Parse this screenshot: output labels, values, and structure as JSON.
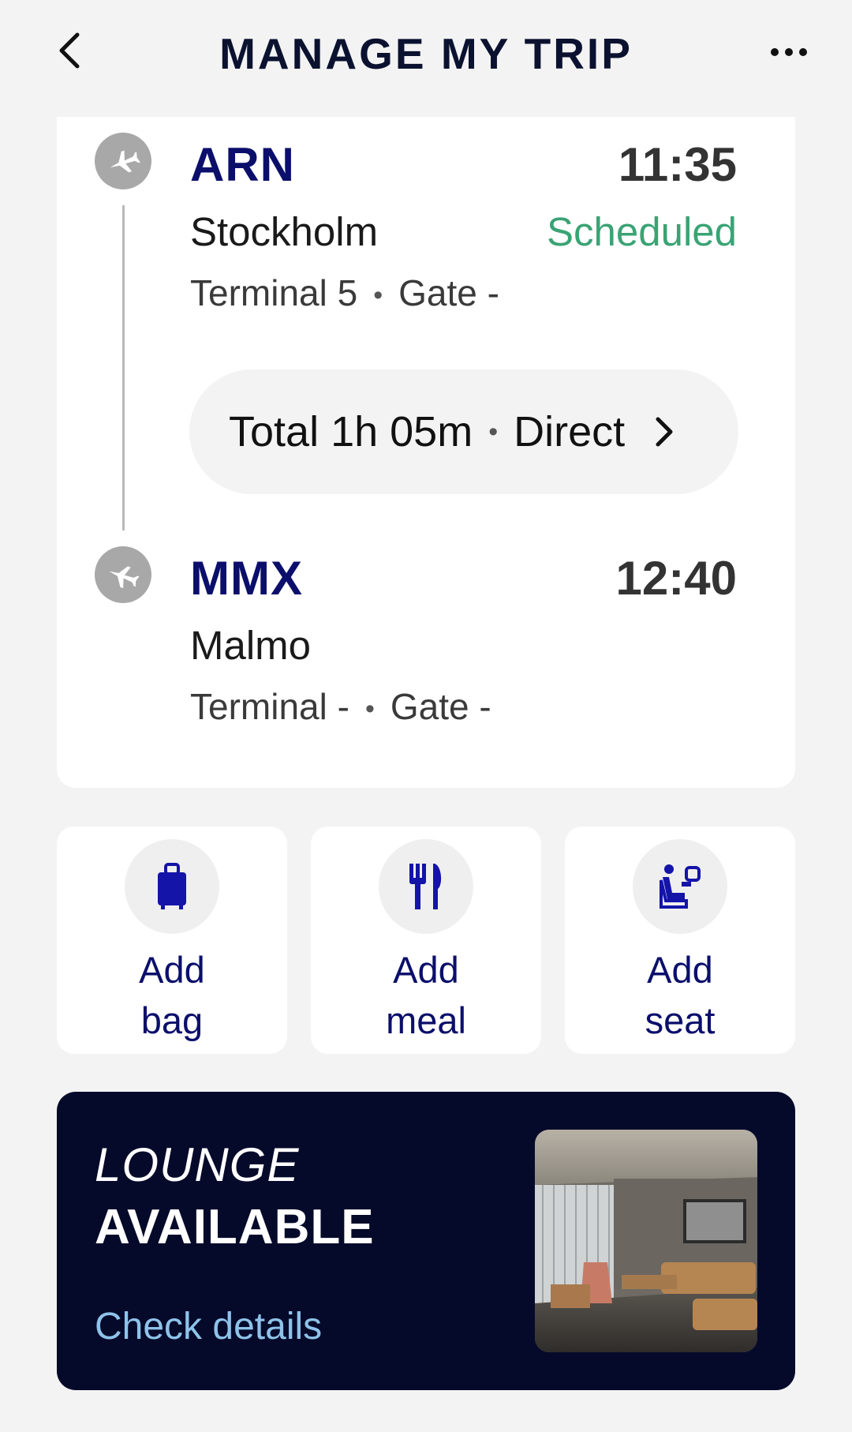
{
  "header": {
    "title": "MANAGE MY TRIP",
    "back_icon": "chevron-left-icon",
    "more_icon": "more-horizontal-icon"
  },
  "flight": {
    "departure": {
      "code": "ARN",
      "time": "11:35",
      "city": "Stockholm",
      "status": "Scheduled",
      "terminal": "Terminal 5",
      "gate": "Gate -",
      "icon": "plane-takeoff-icon"
    },
    "summary": {
      "duration": "Total 1h 05m",
      "stops": "Direct"
    },
    "arrival": {
      "code": "MMX",
      "time": "12:40",
      "city": "Malmo",
      "terminal": "Terminal -",
      "gate": "Gate -",
      "icon": "plane-landing-icon"
    }
  },
  "actions": [
    {
      "line1": "Add",
      "line2": "bag",
      "icon": "luggage-icon"
    },
    {
      "line1": "Add",
      "line2": "meal",
      "icon": "fork-knife-icon"
    },
    {
      "line1": "Add",
      "line2": "seat",
      "icon": "seat-icon"
    }
  ],
  "lounge": {
    "line1": "LOUNGE",
    "line2": "AVAILABLE",
    "link": "Check details"
  },
  "colors": {
    "brand_navy": "#0b0f6b",
    "status_green": "#3aa374",
    "banner_bg": "#060a2a",
    "link_blue": "#8ec3ea"
  }
}
